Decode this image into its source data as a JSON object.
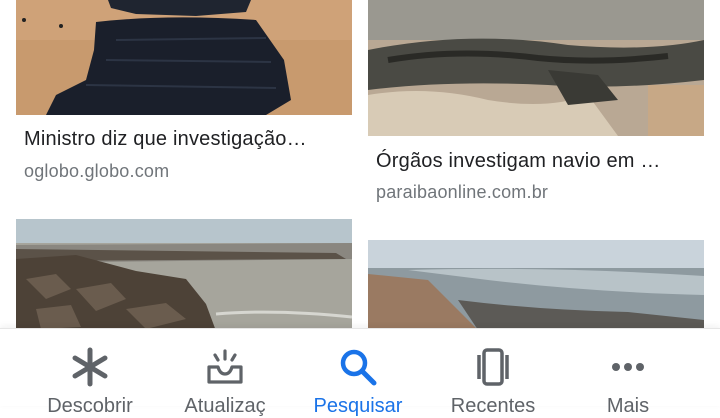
{
  "results": [
    {
      "title": "Ministro diz que investigação…",
      "source": "oglobo.globo.com"
    },
    {
      "title": "Órgãos investigam navio em …",
      "source": "paraibaonline.com.br"
    },
    {
      "title": "",
      "source": ""
    },
    {
      "title": "",
      "source": ""
    }
  ],
  "nav": {
    "items": [
      {
        "label": "Descobrir",
        "icon": "asterisk-icon"
      },
      {
        "label": "Atualizaç",
        "icon": "inbox-icon"
      },
      {
        "label": "Pesquisar",
        "icon": "search-icon",
        "active": true
      },
      {
        "label": "Recentes",
        "icon": "recents-icon"
      },
      {
        "label": "Mais",
        "icon": "more-icon"
      }
    ]
  },
  "colors": {
    "active": "#1a73e8",
    "inactive": "#5f6368",
    "text": "#202124",
    "source": "#70757a"
  }
}
